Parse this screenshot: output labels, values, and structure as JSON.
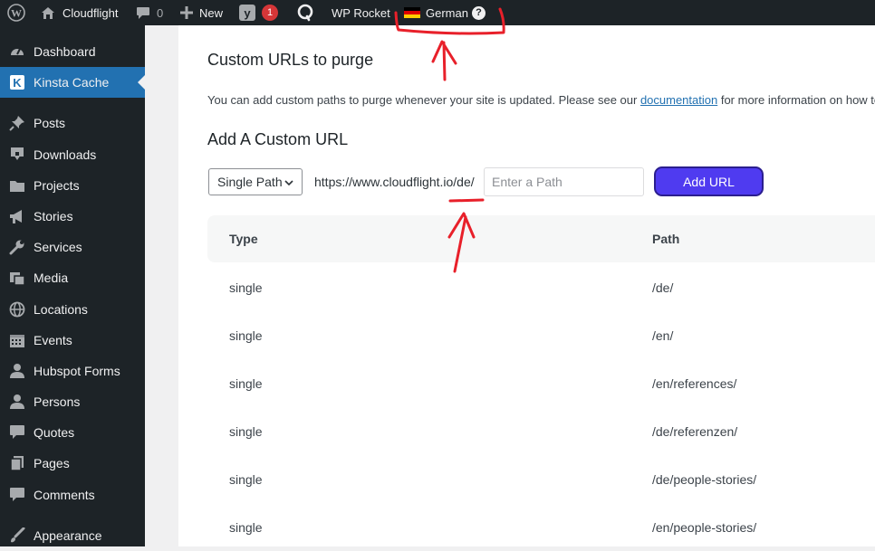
{
  "admin_bar": {
    "site_name": "Cloudflight",
    "comments_count": "0",
    "new_label": "New",
    "yoast_notifications": "1",
    "wp_rocket_label": "WP Rocket",
    "language_label": "German",
    "help_glyph": "?"
  },
  "sidebar": {
    "items": [
      {
        "label": "Dashboard",
        "icon": "dashboard-icon"
      },
      {
        "label": "Kinsta Cache",
        "icon": "kinsta-icon",
        "current": true
      },
      {
        "label": "Posts",
        "icon": "pin-icon"
      },
      {
        "label": "Downloads",
        "icon": "download-icon"
      },
      {
        "label": "Projects",
        "icon": "folder-icon"
      },
      {
        "label": "Stories",
        "icon": "megaphone-icon"
      },
      {
        "label": "Services",
        "icon": "wrench-icon"
      },
      {
        "label": "Media",
        "icon": "media-icon"
      },
      {
        "label": "Locations",
        "icon": "globe-icon"
      },
      {
        "label": "Events",
        "icon": "calendar-icon"
      },
      {
        "label": "Hubspot Forms",
        "icon": "user-icon"
      },
      {
        "label": "Persons",
        "icon": "user-icon"
      },
      {
        "label": "Quotes",
        "icon": "comment-icon"
      },
      {
        "label": "Pages",
        "icon": "pages-icon"
      },
      {
        "label": "Comments",
        "icon": "comment-icon"
      },
      {
        "label": "Appearance",
        "icon": "brush-icon"
      }
    ]
  },
  "main": {
    "section_title": "Custom URLs to purge",
    "description_before": "You can add custom paths to purge whenever your site is updated. Please see our ",
    "description_link": "documentation",
    "description_after": " for more information on how to",
    "add_title": "Add A Custom URL",
    "type_select_value": "Single Path",
    "url_prefix": "https://www.cloudflight.io/de/",
    "path_placeholder": "Enter a Path",
    "add_button_label": "Add URL",
    "table": {
      "headers": [
        "Type",
        "Path"
      ],
      "rows": [
        {
          "type": "single",
          "path": "/de/"
        },
        {
          "type": "single",
          "path": "/en/"
        },
        {
          "type": "single",
          "path": "/en/references/"
        },
        {
          "type": "single",
          "path": "/de/referenzen/"
        },
        {
          "type": "single",
          "path": "/de/people-stories/"
        },
        {
          "type": "single",
          "path": "/en/people-stories/"
        }
      ]
    }
  },
  "colors": {
    "admin_bg": "#1d2327",
    "accent": "#2271b1",
    "button": "#4f3bf0",
    "annotation": "#e8202a"
  }
}
